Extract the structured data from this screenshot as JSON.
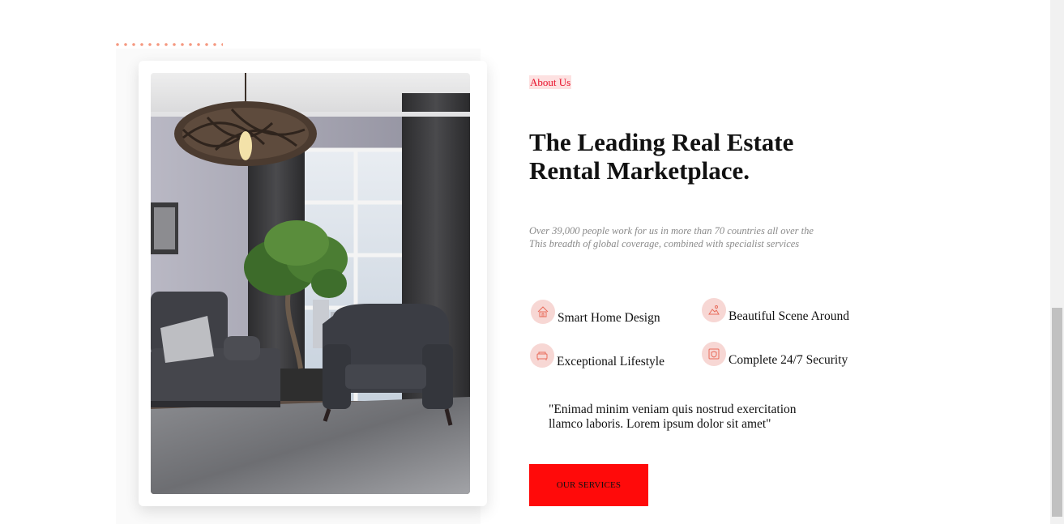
{
  "about": {
    "tagline": "About Us",
    "heading_line1": "The Leading Real Estate",
    "heading_line2": "Rental Marketplace.",
    "description_line1": "Over 39,000 people work for us in more than 70 countries all over the",
    "description_line2": "This breadth of global coverage, combined with specialist services"
  },
  "features": [
    {
      "label": "Smart Home Design",
      "icon": "smart-home-icon"
    },
    {
      "label": "Beautiful Scene Around",
      "icon": "scene-icon"
    },
    {
      "label": "Exceptional Lifestyle",
      "icon": "lifestyle-icon"
    },
    {
      "label": "Complete 24/7 Security",
      "icon": "security-icon"
    }
  ],
  "quote": {
    "line1": "\"Enimad minim veniam quis nostrud exercitation",
    "line2": "llamco laboris. Lorem ipsum dolor sit amet\""
  },
  "cta": {
    "label": "OUR SERVICES"
  },
  "colors": {
    "accent": "#ff0a0a",
    "tag_bg": "#fde1e1",
    "icon_bg": "#f7d7d4",
    "dots": "#f59a82"
  }
}
